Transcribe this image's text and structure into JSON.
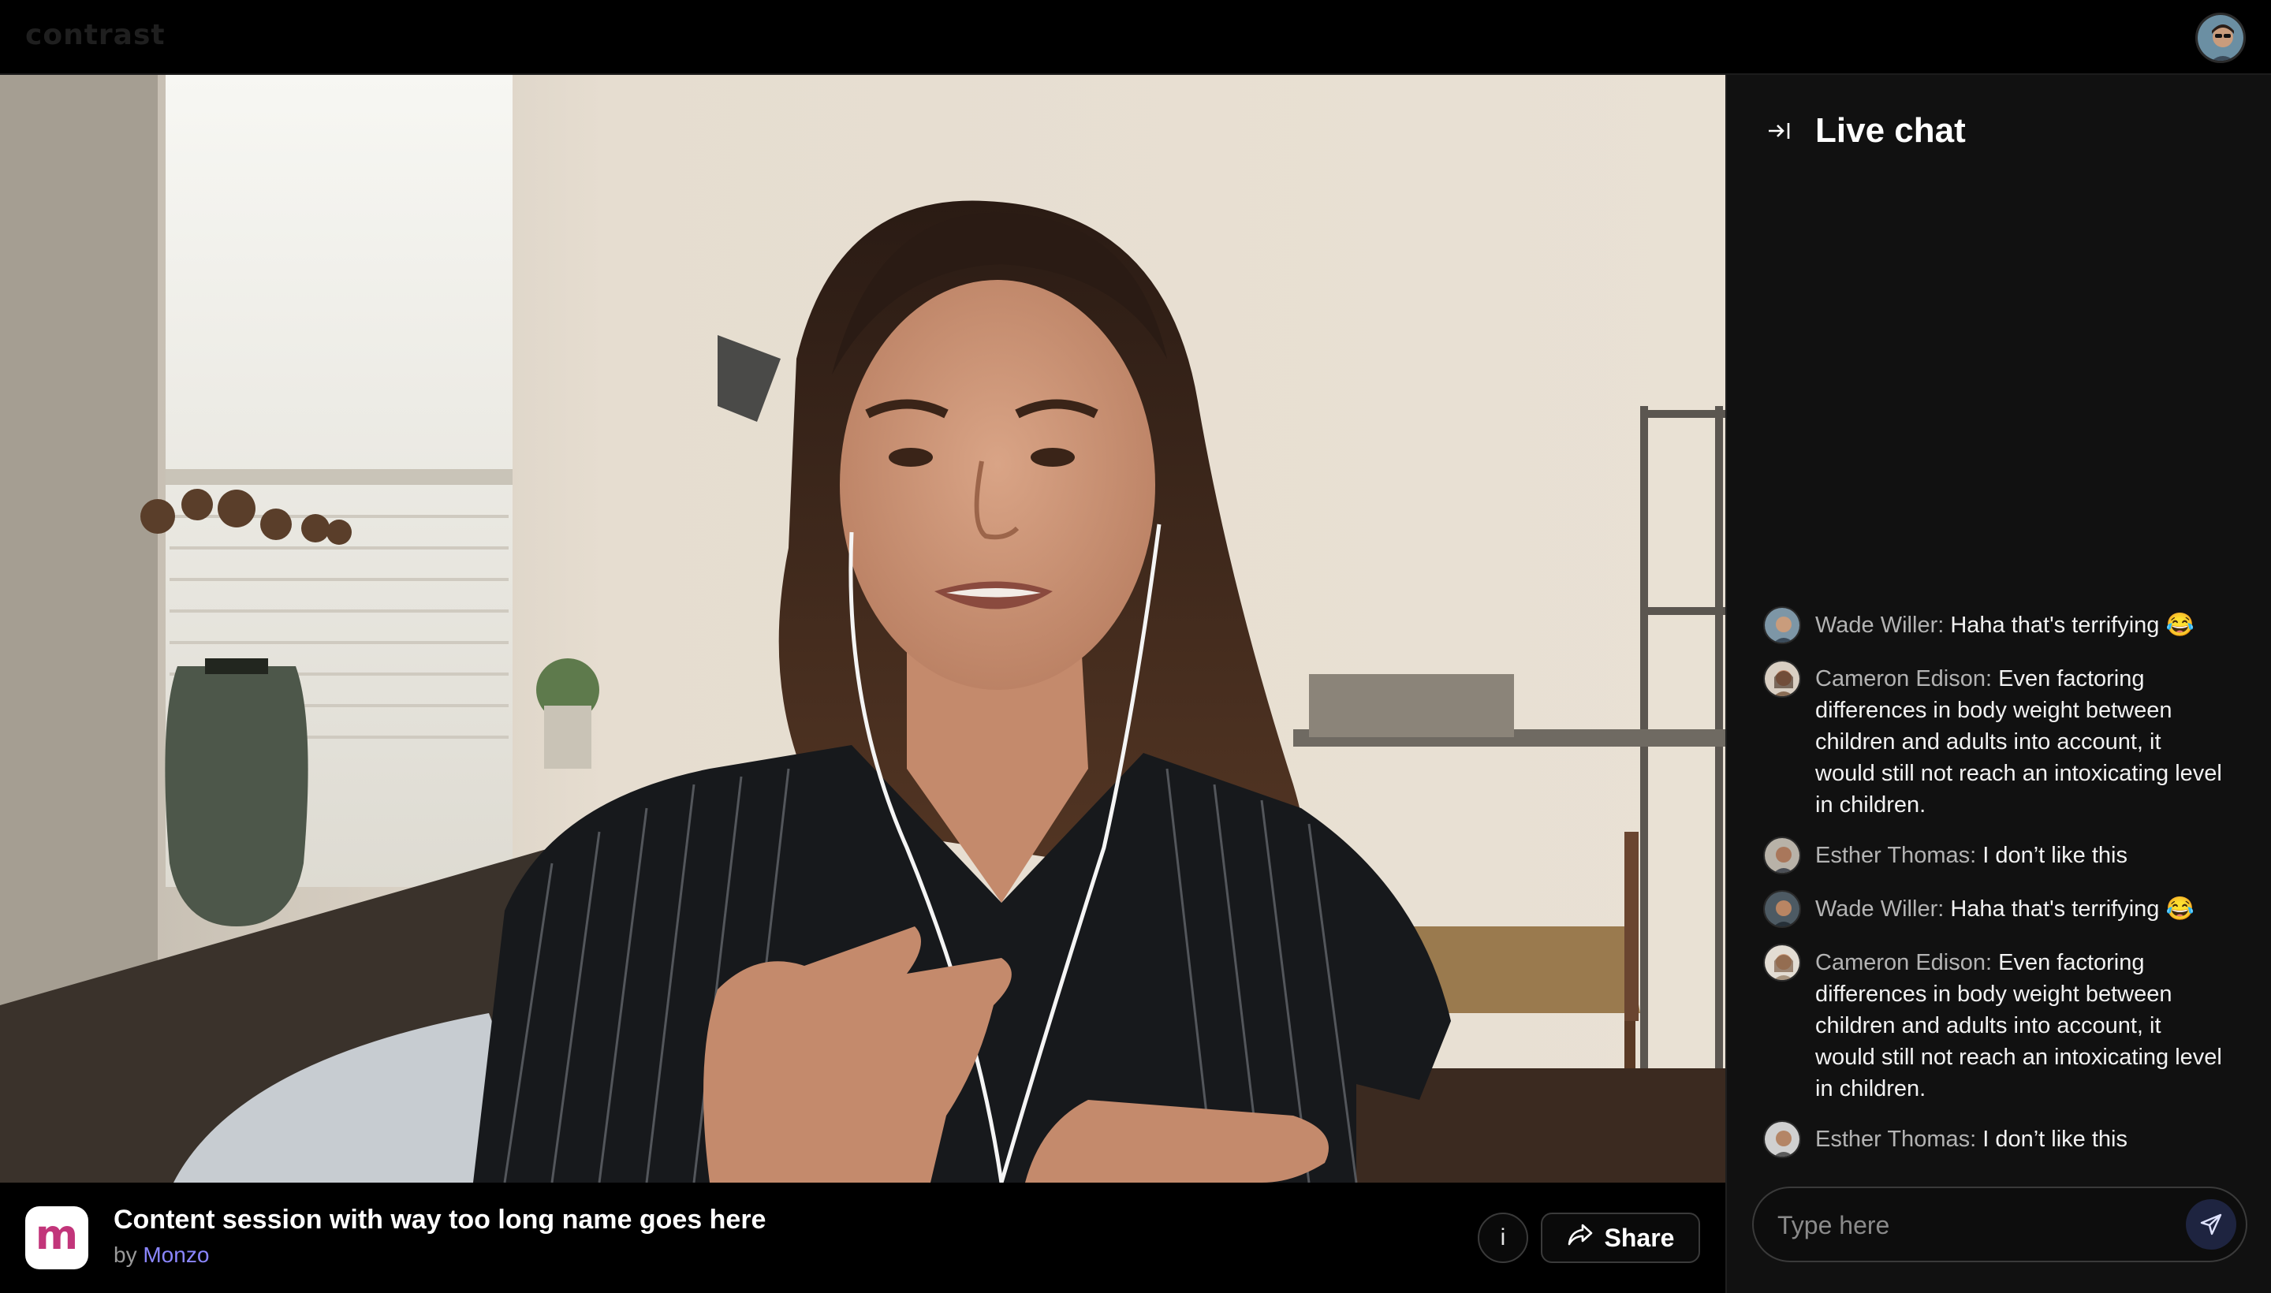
{
  "app": {
    "logo_text": "contrast"
  },
  "session": {
    "brand_letter": "m",
    "title": "Content session with way too long name goes here",
    "by_prefix": "by",
    "org": "Monzo"
  },
  "controls": {
    "info_label": "i",
    "share_label": "Share"
  },
  "chat": {
    "title": "Live chat",
    "messages": [
      {
        "name": "Wade Willer:",
        "text": "Haha that's terrifying 😂"
      },
      {
        "name": "Cameron Edison:",
        "text": "Even factoring differences in body weight between children and adults into account, it would still not reach an intoxicating level in children."
      },
      {
        "name": "Esther Thomas:",
        "text": "I don’t like this"
      },
      {
        "name": "Wade Willer:",
        "text": "Haha that's terrifying 😂"
      },
      {
        "name": "Cameron Edison:",
        "text": "Even factoring differences in body weight between children and adults into account, it would still not reach an intoxicating level in children."
      },
      {
        "name": "Esther Thomas:",
        "text": "I don’t like this"
      }
    ],
    "input_placeholder": "Type here"
  },
  "colors": {
    "accent": "#8b86ff",
    "brand": "#c2357a",
    "send_bg": "#1e2440",
    "panel": "#111111"
  }
}
